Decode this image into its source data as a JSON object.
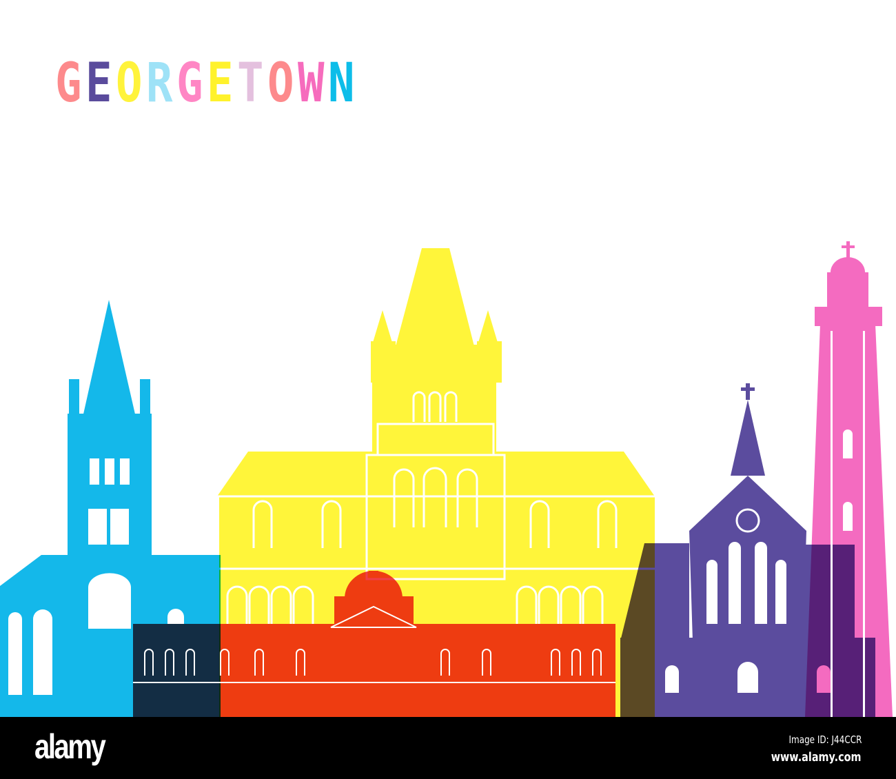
{
  "title": {
    "text": "GEORGETOWN",
    "letters": [
      "G",
      "E",
      "O",
      "R",
      "G",
      "E",
      "T",
      "O",
      "W",
      "N"
    ],
    "colors": [
      "#fd8a8c",
      "#5a4b9c",
      "#fff33b",
      "#9ee2f7",
      "#ff86c4",
      "#fff22c",
      "#e4c0de",
      "#fd8a8c",
      "#f66cbd",
      "#0dbde9"
    ]
  },
  "palette": {
    "blue": "#14b8ea",
    "yellow": "#fff53a",
    "red": "#ee3340",
    "purple": "#5b4c9e",
    "pink": "#f46bc0"
  },
  "footer": {
    "logo": "alamy",
    "image_id": "Image ID: J44CCR",
    "url": "www.alamy.com"
  }
}
